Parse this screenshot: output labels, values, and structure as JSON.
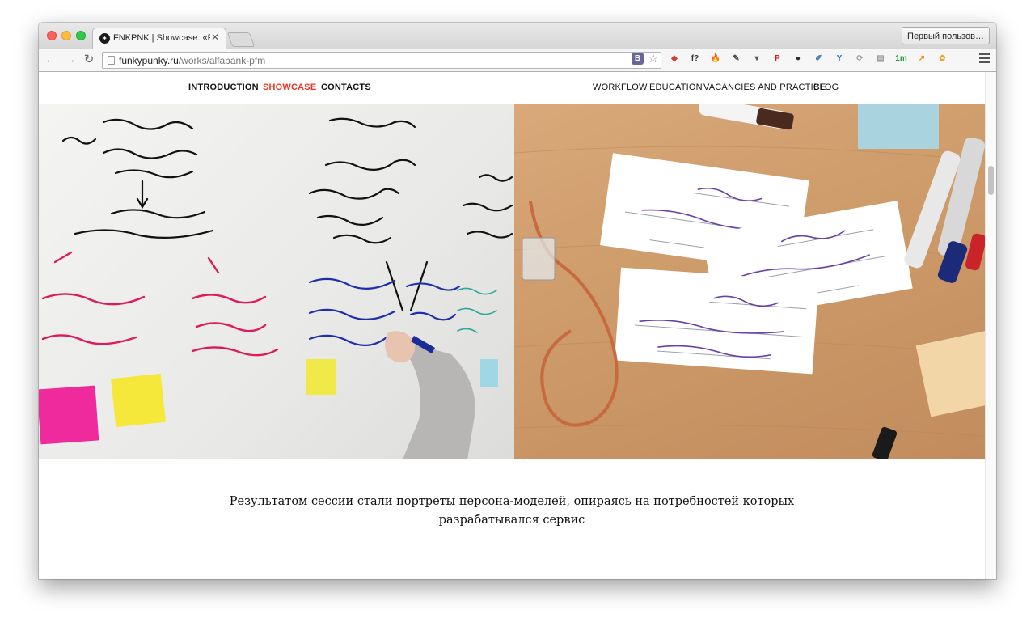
{
  "browser": {
    "tab_title": "FNKPNK | Showcase: «Рас",
    "tab_close": "✕",
    "profile_button": "Первый пользов…",
    "url_host": "funkypunky.ru",
    "url_path": "/works/alfabank-pfm",
    "vk_label": "B",
    "star": "☆",
    "back": "←",
    "forward": "→",
    "reload": "↻",
    "extensions": [
      {
        "name": "adblock-icon",
        "glyph": "◆",
        "color": "#d93a30"
      },
      {
        "name": "font-icon",
        "glyph": "f?",
        "color": "#333333"
      },
      {
        "name": "fire-icon",
        "glyph": "🔥",
        "color": "#e8731c"
      },
      {
        "name": "evernote-icon",
        "glyph": "✎",
        "color": "#4a4a4a"
      },
      {
        "name": "pocket-icon",
        "glyph": "▾",
        "color": "#555555"
      },
      {
        "name": "pinterest-icon",
        "glyph": "P",
        "color": "#cb2027"
      },
      {
        "name": "camera-icon",
        "glyph": "●",
        "color": "#2b2b2b"
      },
      {
        "name": "eyedropper-icon",
        "glyph": "✐",
        "color": "#3a6ea5"
      },
      {
        "name": "yandex-icon",
        "glyph": "Y",
        "color": "#1f78c8"
      },
      {
        "name": "sync-icon",
        "glyph": "⟳",
        "color": "#9a9a9a"
      },
      {
        "name": "reader-icon",
        "glyph": "▤",
        "color": "#9a9a9a"
      },
      {
        "name": "mail-icon",
        "glyph": "1m",
        "color": "#2f9a3a"
      },
      {
        "name": "stats-icon",
        "glyph": "↗",
        "color": "#f08a1c"
      },
      {
        "name": "flower-icon",
        "glyph": "✿",
        "color": "#e8a41c"
      }
    ]
  },
  "site": {
    "nav_left": [
      {
        "label": "INTRODUCTION",
        "active": false
      },
      {
        "label": "SHOWCASE",
        "active": true
      },
      {
        "label": "CONTACTS",
        "active": false
      }
    ],
    "nav_right": [
      {
        "label": "WORKFLOW"
      },
      {
        "label": "EDUCATION"
      },
      {
        "label": "VACANCIES AND PRACTICE"
      },
      {
        "label": "BLOG"
      }
    ]
  },
  "hero": {
    "left_photo_alt": "",
    "right_photo_alt": ""
  },
  "caption": {
    "line1": "Результатом сессии стали портреты персона-моделей, опираясь на потребностей которых",
    "line2": "разрабатывался сервис"
  },
  "colors": {
    "accent": "#ef3124",
    "text": "#111111"
  }
}
